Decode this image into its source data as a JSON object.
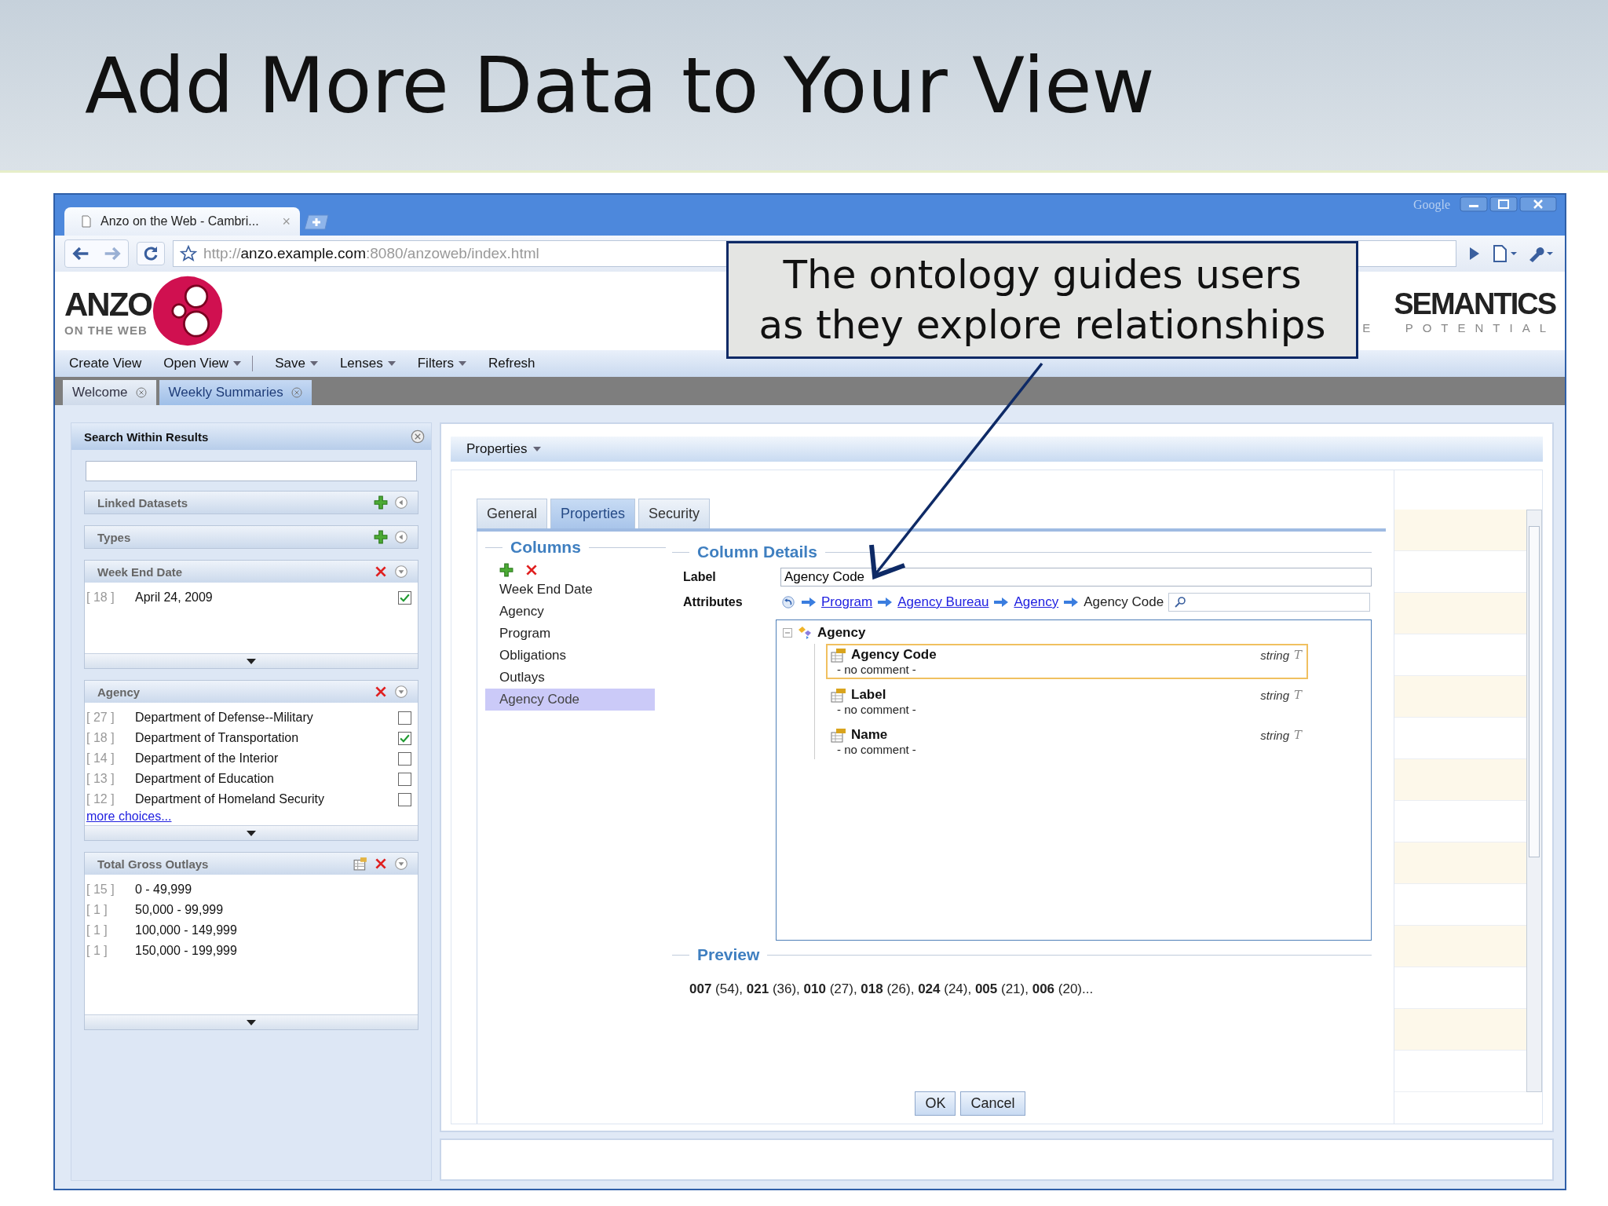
{
  "slide_title": "Add More Data to Your View",
  "browser": {
    "tab_title": "Anzo on the Web - Cambri...",
    "tab_close": "×",
    "brand": "Google",
    "url_scheme": "http://",
    "url_host": "anzo.example.com",
    "url_rest": ":8080/anzoweb/index.html"
  },
  "app": {
    "logo_text": "ANZO",
    "logo_sub": "ON THE WEB",
    "partner_logo": "SEMANTICS",
    "partner_tagline": "E  POTENTIAL"
  },
  "menu": [
    {
      "label": "Create View",
      "dropdown": false,
      "separator": false
    },
    {
      "label": "Open View",
      "dropdown": true,
      "separator": true
    },
    {
      "label": "Save",
      "dropdown": true,
      "separator": false
    },
    {
      "label": "Lenses",
      "dropdown": true,
      "separator": false
    },
    {
      "label": "Filters",
      "dropdown": true,
      "separator": false
    },
    {
      "label": "Refresh",
      "dropdown": false,
      "separator": false
    }
  ],
  "view_tabs": [
    {
      "label": "Welcome",
      "selected": false
    },
    {
      "label": "Weekly Summaries",
      "selected": true
    }
  ],
  "sidebar": {
    "title": "Search Within Results",
    "facets": [
      {
        "kind": "collapsed",
        "title": "Linked Datasets"
      },
      {
        "kind": "collapsed",
        "title": "Types"
      },
      {
        "kind": "list",
        "title": "Week End Date",
        "items": [
          {
            "count": "[ 18 ]",
            "label": "April 24, 2009",
            "checked": true
          }
        ]
      },
      {
        "kind": "list",
        "title": "Agency",
        "more": "more choices...",
        "items": [
          {
            "count": "[ 27 ]",
            "label": "Department of Defense--Military",
            "checked": false
          },
          {
            "count": "[ 18 ]",
            "label": "Department of Transportation",
            "checked": true
          },
          {
            "count": "[ 14 ]",
            "label": "Department of the Interior",
            "checked": false
          },
          {
            "count": "[ 13 ]",
            "label": "Department of Education",
            "checked": false
          },
          {
            "count": "[ 12 ]",
            "label": "Department of Homeland Security",
            "checked": false
          }
        ]
      },
      {
        "kind": "range",
        "title": "Total Gross Outlays",
        "items": [
          {
            "count": "[ 15 ]",
            "label": "0 - 49,999"
          },
          {
            "count": "[ 1 ]",
            "label": "50,000 - 99,999"
          },
          {
            "count": "[ 1 ]",
            "label": "100,000 - 149,999"
          },
          {
            "count": "[ 1 ]",
            "label": "150,000 - 199,999"
          }
        ]
      }
    ]
  },
  "panel": {
    "title": "Properties"
  },
  "dialog": {
    "tabs": [
      {
        "label": "General",
        "selected": false
      },
      {
        "label": "Properties",
        "selected": true
      },
      {
        "label": "Security",
        "selected": false
      }
    ],
    "columns_heading": "Columns",
    "columns": [
      {
        "label": "Week End Date",
        "selected": false
      },
      {
        "label": "Agency",
        "selected": false
      },
      {
        "label": "Program",
        "selected": false
      },
      {
        "label": "Obligations",
        "selected": false
      },
      {
        "label": "Outlays",
        "selected": false
      },
      {
        "label": "Agency Code",
        "selected": true
      }
    ],
    "details_heading": "Column Details",
    "label_caption": "Label",
    "label_value": "Agency Code",
    "attributes_caption": "Attributes",
    "path": [
      {
        "label": "Program",
        "link": true
      },
      {
        "label": "Agency Bureau",
        "link": true
      },
      {
        "label": "Agency",
        "link": true
      },
      {
        "label": "Agency Code",
        "link": false
      }
    ],
    "tree": {
      "root": "Agency",
      "expanded": true,
      "children": [
        {
          "name": "Agency Code",
          "comment": "- no comment -",
          "type": "string",
          "type_mark": "T",
          "selected": true
        },
        {
          "name": "Label",
          "comment": "- no comment -",
          "type": "string",
          "type_mark": "T",
          "selected": false
        },
        {
          "name": "Name",
          "comment": "- no comment -",
          "type": "string",
          "type_mark": "T",
          "selected": false
        }
      ]
    },
    "preview_heading": "Preview",
    "preview": "**007** (54), **021** (36), **010** (27), **018** (26), **024** (24), **005** (21), **006** (20)...",
    "buttons": [
      "OK",
      "Cancel"
    ]
  },
  "callout": {
    "lines": [
      "The ontology guides users",
      "as they explore relationships"
    ]
  }
}
